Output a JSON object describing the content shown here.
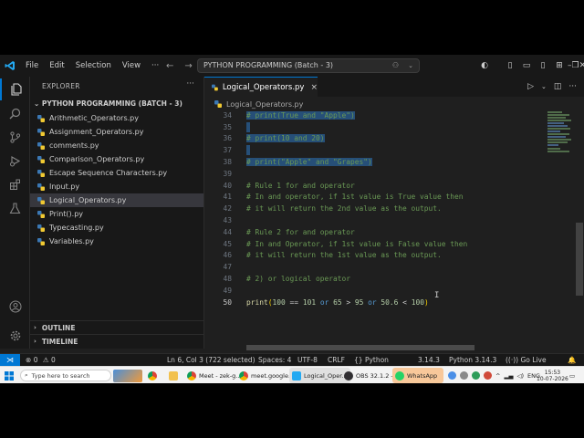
{
  "menu": [
    "File",
    "Edit",
    "Selection",
    "View"
  ],
  "command_center": "PYTHON PROGRAMMING (Batch - 3)",
  "explorer": {
    "title": "EXPLORER",
    "folder": "PYTHON PROGRAMMING (BATCH - 3)",
    "files": [
      "Arithmetic_Operators.py",
      "Assignment_Operators.py",
      "comments.py",
      "Comparison_Operators.py",
      "Escape Sequence Characters.py",
      "Input.py",
      "Logical_Operators.py",
      "Print().py",
      "Typecasting.py",
      "Variables.py"
    ],
    "active_index": 6,
    "outline": "OUTLINE",
    "timeline": "TIMELINE"
  },
  "tab": {
    "label": "Logical_Operators.py",
    "close": "×"
  },
  "breadcrumb": "Logical_Operators.py",
  "line_numbers": [
    "34",
    "35",
    "36",
    "37",
    "38",
    "39",
    "40",
    "41",
    "42",
    "43",
    "44",
    "45",
    "46",
    "47",
    "48",
    "49",
    "50"
  ],
  "code": {
    "l34": "# print(True and \"Apple\")",
    "l36": "# print(10 and 20)",
    "l38": "# print(\"Apple\" and \"Grapes\")",
    "l40": "# Rule 1 for and operator",
    "l41": "# In and operator, if 1st value is True value then",
    "l42": "# it will return the 2nd value as the output.",
    "l44": "# Rule 2 for and operator",
    "l45": "# In and Operator, if 1st value is False value then",
    "l46": "# it will return the 1st value as the output.",
    "l48": "# 2) or logical operator",
    "l50": {
      "fn": "print",
      "open": "(",
      "a": "100",
      "op1": " == ",
      "b": "101",
      "kw1": " or ",
      "c": "65",
      "op2": " > ",
      "d": "95",
      "kw2": " or ",
      "e": "50.6",
      "op3": " < ",
      "f": "100",
      "close": ")"
    }
  },
  "status": {
    "errors": "0",
    "warnings": "0",
    "position": "Ln 6, Col 3 (722 selected)",
    "spaces": "Spaces: 4",
    "encoding": "UTF-8",
    "eol": "CRLF",
    "language": "Python",
    "version": "3.14.3",
    "interpreter": "Python 3.14.3",
    "golive": "Go Live"
  },
  "taskbar": {
    "search_placeholder": "Type here to search",
    "apps": [
      "Meet - zek-g...",
      "meet.google....",
      "Logical_Oper...",
      "OBS 32.1.2 - ...",
      "WhatsApp"
    ],
    "lang": "ENG",
    "time": "15:53",
    "date": "10-07-2026"
  },
  "colors": {
    "accent": "#0078d4",
    "selection": "#264f78",
    "comment": "#6a9955",
    "number": "#b5cea8",
    "keyword": "#569cd6",
    "function": "#dcdcaa"
  }
}
